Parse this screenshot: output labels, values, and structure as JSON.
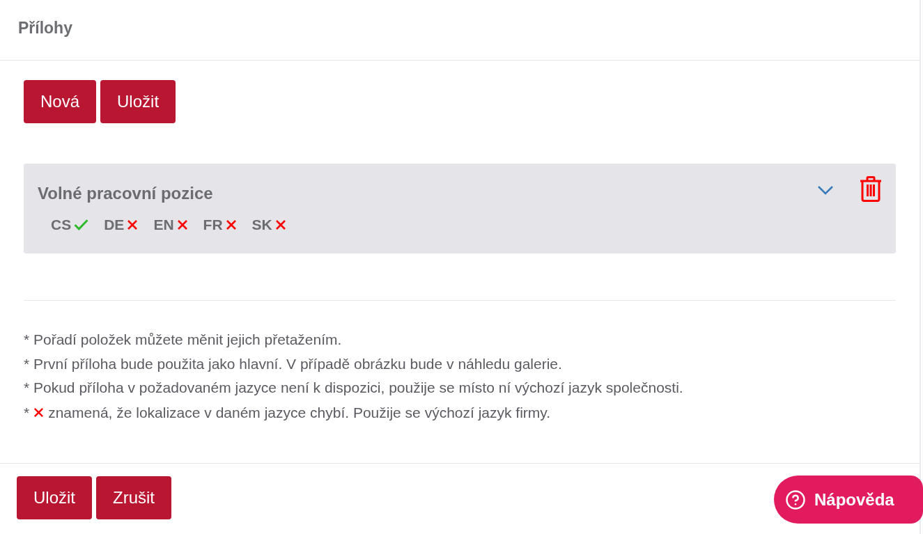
{
  "header": {
    "title": "Přílohy"
  },
  "toolbar": {
    "buttons": [
      "Nová",
      "Uložit"
    ]
  },
  "attachments": [
    {
      "title": "Volné pracovní pozice",
      "expanded": false,
      "languages": [
        {
          "code": "CS",
          "available": true
        },
        {
          "code": "DE",
          "available": false
        },
        {
          "code": "EN",
          "available": false
        },
        {
          "code": "FR",
          "available": false
        },
        {
          "code": "SK",
          "available": false
        }
      ]
    }
  ],
  "notes": [
    {
      "kind": "text",
      "text": "* Pořadí položek můžete měnit jejich přetažením."
    },
    {
      "kind": "text",
      "text": "* První příloha bude použita jako hlavní. V případě obrázku bude v náhledu galerie."
    },
    {
      "kind": "text",
      "text": "* Pokud příloha v požadovaném jazyce není k dispozici, použije se místo ní výchozí jazyk společnosti."
    },
    {
      "kind": "missing-legend",
      "prefix": "*",
      "text": "znamená, že lokalizace v daném jazyce chybí. Použije se výchozí jazyk firmy."
    }
  ],
  "footer": {
    "buttons": [
      "Uložit",
      "Zrušit"
    ]
  },
  "help_button": {
    "label": "Nápověda"
  }
}
